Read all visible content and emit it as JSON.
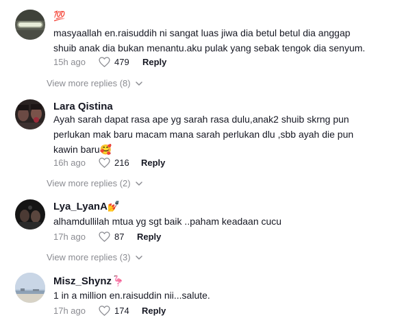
{
  "comments": [
    {
      "username": "💯",
      "text_lines": [
        "masyaallah en.raisuddih ni sangat luas jiwa dia betul betul dia anggap",
        "shuib anak dia bukan menantu.aku pulak yang sebak tengok dia senyum."
      ],
      "time": "15h ago",
      "likes": "479",
      "reply_label": "Reply",
      "view_more": "View more replies (8)"
    },
    {
      "username": "Lara Qistina",
      "text_lines": [
        "Ayah sarah dapat rasa ape yg sarah rasa dulu,anak2 shuib skrng pun",
        "perlukan mak baru macam mana sarah perlukan dlu ,sbb ayah die pun",
        "kawin baru🥰"
      ],
      "time": "16h ago",
      "likes": "216",
      "reply_label": "Reply",
      "view_more": "View more replies (2)"
    },
    {
      "username": "Lya_LyanA💅",
      "text_lines": [
        "alhamdullilah mtua yg sgt baik ..paham keadaan cucu"
      ],
      "time": "17h ago",
      "likes": "87",
      "reply_label": "Reply",
      "view_more": "View more replies (3)"
    },
    {
      "username": "Misz_Shynz🦩",
      "text_lines": [
        "1 in a million en.raisuddin nii...salute."
      ],
      "time": "17h ago",
      "likes": "174",
      "reply_label": "Reply"
    }
  ],
  "icons": {
    "like": "heart-outline-icon",
    "expand": "chevron-down-icon"
  },
  "colors": {
    "text": "#161823",
    "muted": "#8a8b91",
    "background": "#ffffff"
  }
}
